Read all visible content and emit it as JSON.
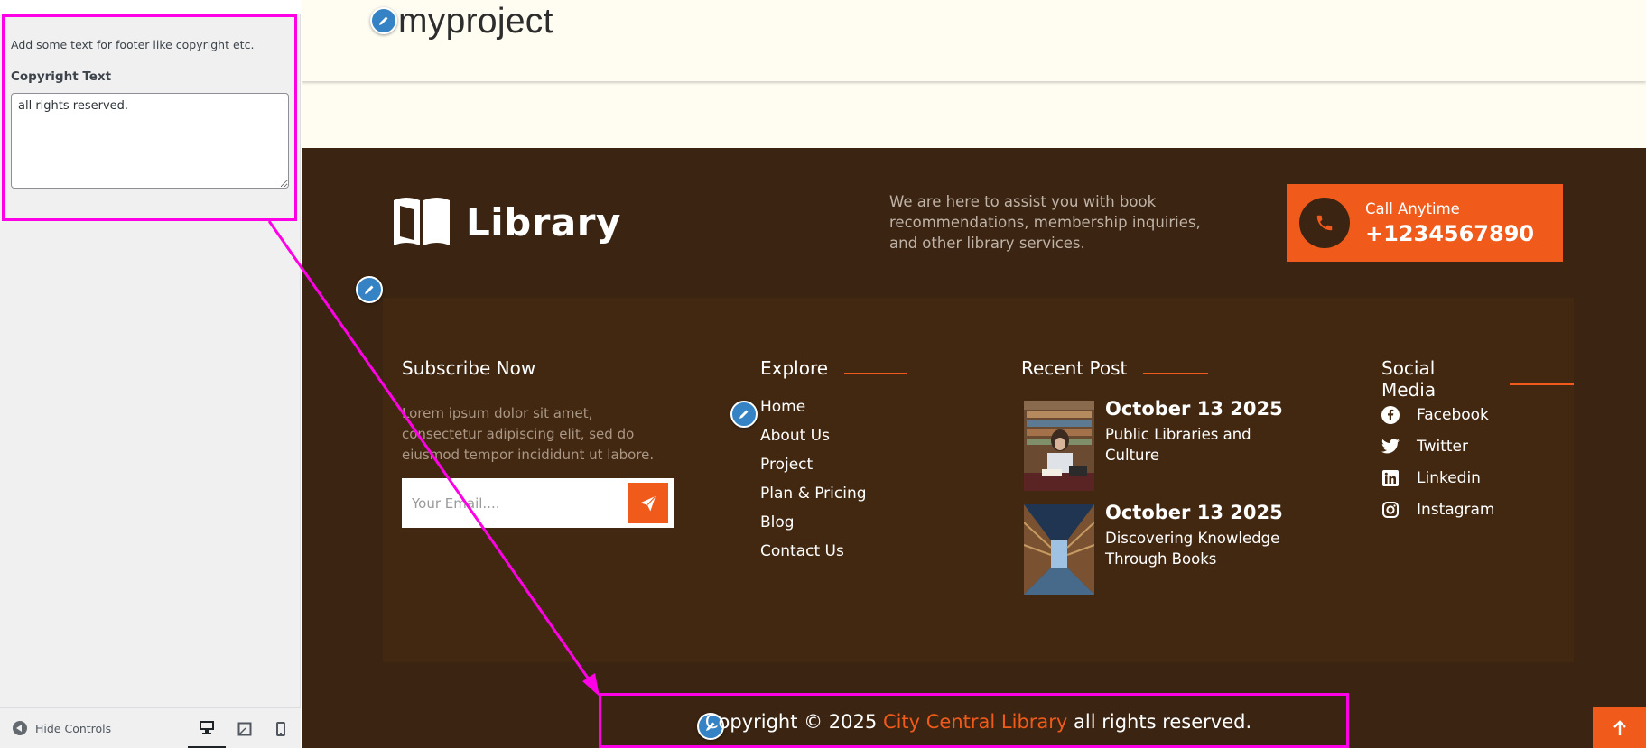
{
  "customizer": {
    "section_description": "Add some text for footer like copyright etc.",
    "copyright_field_label": "Copyright Text",
    "copyright_field_value": "all rights reserved.",
    "hide_controls_label": "Hide Controls",
    "devices": [
      "desktop",
      "tablet",
      "mobile"
    ],
    "active_device": "desktop"
  },
  "site": {
    "title": "myproject"
  },
  "footer": {
    "logo_text": "Library",
    "assist_text": "We are here to assist you with book recommendations, membership inquiries, and other library services.",
    "call_label": "Call Anytime",
    "call_number": "+1234567890",
    "subscribe": {
      "title": "Subscribe Now",
      "text": "Lorem ipsum dolor sit amet, consectetur adipiscing elit, sed do eiusmod tempor incididunt ut labore.",
      "email_placeholder": "Your Email...."
    },
    "explore": {
      "title": "Explore",
      "links": [
        "Home",
        "About Us",
        "Project",
        "Plan & Pricing",
        "Blog",
        "Contact Us"
      ]
    },
    "recent_post": {
      "title": "Recent Post",
      "posts": [
        {
          "date": "October 13 2025",
          "title": "Public Libraries and Culture"
        },
        {
          "date": "October 13 2025",
          "title": "Discovering Knowledge Through Books"
        }
      ]
    },
    "social": {
      "title": "Social Media",
      "links": [
        "Facebook",
        "Twitter",
        "Linkedin",
        "Instagram"
      ]
    },
    "copyright": {
      "prefix": "Copyright © 2025",
      "site_name": "City Central Library",
      "suffix": "all rights reserved."
    }
  },
  "colors": {
    "accent": "#f05a1a",
    "footer_bg": "#3b2411",
    "highlight": "#ff00e6",
    "edit_pencil": "#3582c4"
  }
}
